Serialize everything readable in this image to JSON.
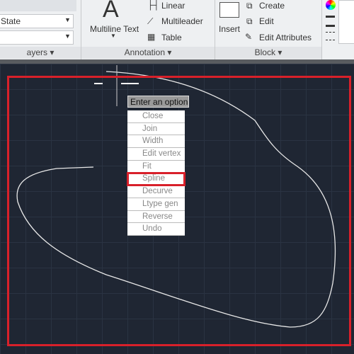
{
  "ribbon": {
    "layers": {
      "state_value": "State",
      "panel_label": "ayers"
    },
    "annotation": {
      "multiline_text": "Multiline Text",
      "linear": "Linear",
      "multileader": "Multileader",
      "table": "Table",
      "panel_label": "Annotation",
      "big_glyph": "A"
    },
    "block": {
      "insert": "Insert",
      "create": "Create",
      "edit": "Edit",
      "edit_attributes": "Edit Attributes",
      "panel_label": "Block"
    }
  },
  "menu": {
    "header": "Enter an option",
    "items": [
      "Close",
      "Join",
      "Width",
      "Edit vertex",
      "Fit",
      "Spline",
      "Decurve",
      "Ltype gen",
      "Reverse",
      "Undo"
    ],
    "highlighted": "Spline"
  },
  "colors": {
    "highlight": "#d8202a",
    "canvas": "#1f2633"
  }
}
